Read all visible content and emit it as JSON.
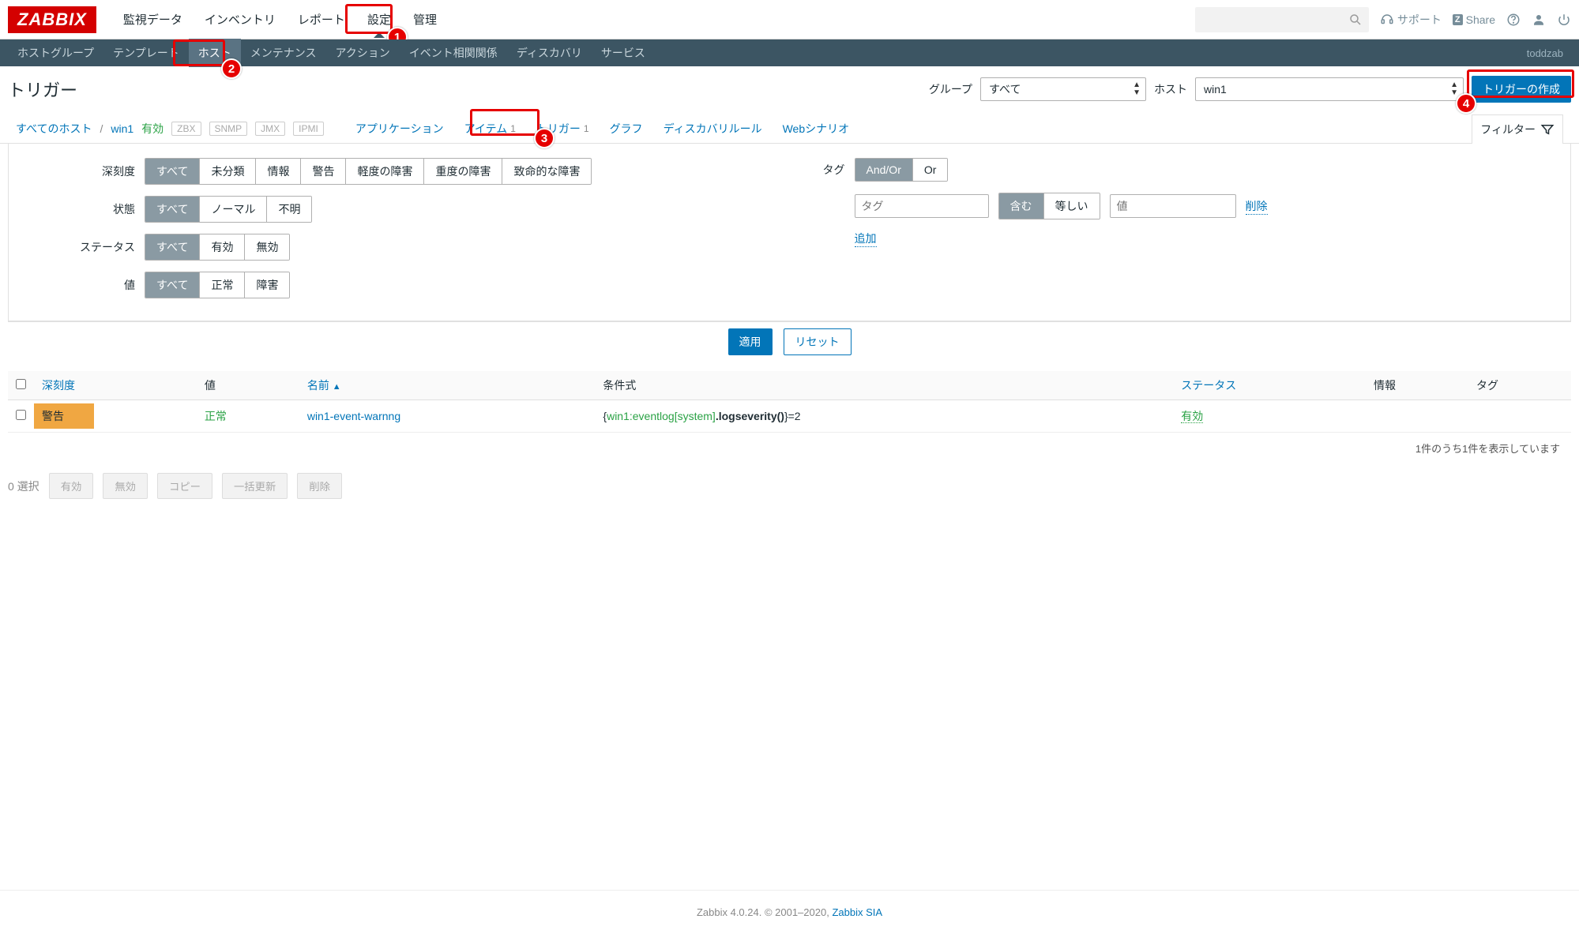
{
  "logo": "ZABBIX",
  "topnav": [
    "監視データ",
    "インベントリ",
    "レポート",
    "設定",
    "管理"
  ],
  "topnav_active": 3,
  "topright": {
    "support": "サポート",
    "share": "Share"
  },
  "subnav": [
    "ホストグループ",
    "テンプレート",
    "ホスト",
    "メンテナンス",
    "アクション",
    "イベント相関関係",
    "ディスカバリ",
    "サービス"
  ],
  "subnav_active": 2,
  "subnav_user": "toddzab",
  "page_title": "トリガー",
  "header": {
    "group_label": "グループ",
    "group_value": "すべて",
    "host_label": "ホスト",
    "host_value": "win1",
    "create_btn": "トリガーの作成"
  },
  "crumbs": {
    "all": "すべてのホスト",
    "host": "win1",
    "enabled": "有効",
    "chips": [
      "ZBX",
      "SNMP",
      "JMX",
      "IPMI"
    ]
  },
  "tabs": {
    "app": "アプリケーション",
    "items": "アイテム",
    "items_count": "1",
    "triggers": "トリガー",
    "triggers_count": "1",
    "graphs": "グラフ",
    "discovery": "ディスカバリルール",
    "web": "Webシナリオ",
    "filter_label": "フィルター"
  },
  "filter": {
    "severity_label": "深刻度",
    "severity_opts": [
      "すべて",
      "未分類",
      "情報",
      "警告",
      "軽度の障害",
      "重度の障害",
      "致命的な障害"
    ],
    "state_label": "状態",
    "state_opts": [
      "すべて",
      "ノーマル",
      "不明"
    ],
    "status_label": "ステータス",
    "status_opts": [
      "すべて",
      "有効",
      "無効"
    ],
    "value_label": "値",
    "value_opts": [
      "すべて",
      "正常",
      "障害"
    ],
    "tag_label": "タグ",
    "andor_opts": [
      "And/Or",
      "Or"
    ],
    "tag_placeholder": "タグ",
    "contain_opts": [
      "含む",
      "等しい"
    ],
    "value_placeholder": "値",
    "remove": "削除",
    "add": "追加",
    "apply": "適用",
    "reset": "リセット"
  },
  "table": {
    "cols": {
      "severity": "深刻度",
      "value": "値",
      "name": "名前",
      "expr": "条件式",
      "status": "ステータス",
      "info": "情報",
      "tags": "タグ"
    },
    "rows": [
      {
        "severity": "警告",
        "value": "正常",
        "name": "win1-event-warnng",
        "expr_host": "win1:eventlog[system]",
        "expr_func": ".logseverity()",
        "expr_tail": "}=2",
        "status": "有効"
      }
    ],
    "footer": "1件のうち1件を表示しています"
  },
  "actions": {
    "selected": "0 選択",
    "enable": "有効",
    "disable": "無効",
    "copy": "コピー",
    "massupdate": "一括更新",
    "delete": "削除"
  },
  "footer": {
    "text": "Zabbix 4.0.24. © 2001–2020, ",
    "link": "Zabbix SIA"
  },
  "annotations": {
    "n1": "1",
    "n2": "2",
    "n3": "3",
    "n4": "4"
  }
}
